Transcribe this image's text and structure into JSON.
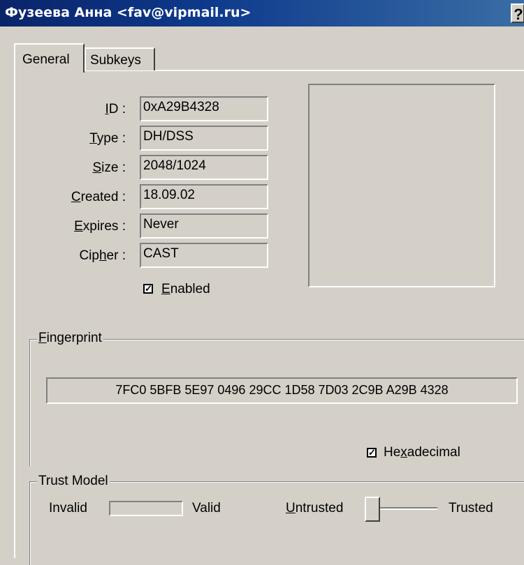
{
  "window": {
    "title": "Фузеева Анна <fav@vipmail.ru>",
    "help_label": "?"
  },
  "tabs": [
    {
      "label": "General"
    },
    {
      "label": "Subkeys"
    }
  ],
  "general": {
    "fields": [
      {
        "label_pre": "",
        "label_u": "I",
        "label_post": "D :",
        "value": "0xA29B4328"
      },
      {
        "label_pre": "",
        "label_u": "T",
        "label_post": "ype :",
        "value": "DH/DSS"
      },
      {
        "label_pre": "",
        "label_u": "S",
        "label_post": "ize :",
        "value": "2048/1024"
      },
      {
        "label_pre": "",
        "label_u": "C",
        "label_post": "reated :",
        "value": "18.09.02"
      },
      {
        "label_pre": "",
        "label_u": "E",
        "label_post": "xpires :",
        "value": "Never"
      },
      {
        "label_pre": "Cip",
        "label_u": "h",
        "label_post": "er :",
        "value": "CAST"
      }
    ],
    "enabled": {
      "u": "E",
      "rest": "nabled",
      "checked": true
    }
  },
  "fingerprint": {
    "title_u": "F",
    "title_rest": "ingerprint",
    "value": "7FC0 5BFB 5E97 0496 29CC  1D58 7D03 2C9B A29B 4328",
    "hex_pre": "He",
    "hex_u": "x",
    "hex_post": "adecimal",
    "hex_checked": true
  },
  "trust": {
    "title": "Trust Model",
    "invalid": "Invalid",
    "valid": "Valid",
    "untrusted_u": "U",
    "untrusted_rest": "ntrusted",
    "trusted": "Trusted",
    "trust_level": 0
  }
}
